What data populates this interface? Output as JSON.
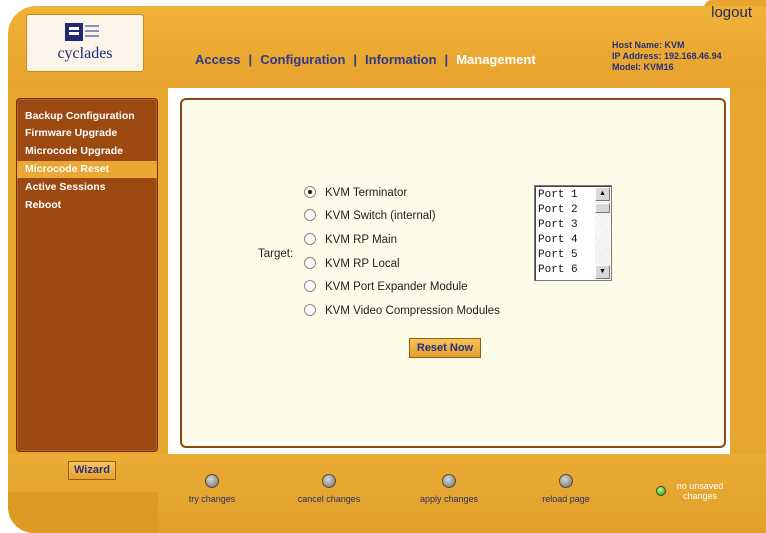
{
  "header": {
    "logo_text": "cyclades",
    "logout_label": "logout",
    "nav": [
      {
        "label": "Access",
        "active": false
      },
      {
        "label": "Configuration",
        "active": false
      },
      {
        "label": "Information",
        "active": false
      },
      {
        "label": "Management",
        "active": true
      }
    ],
    "separator": "|",
    "host_name": "Host Name: KVM",
    "ip_address": "IP Address: 192.168.46.94",
    "model": "Model: KVM16"
  },
  "sidebar": {
    "items": [
      {
        "label": "Backup Configuration",
        "selected": false
      },
      {
        "label": "Firmware Upgrade",
        "selected": false
      },
      {
        "label": "Microcode Upgrade",
        "selected": false
      },
      {
        "label": "Microcode Reset",
        "selected": true
      },
      {
        "label": "Active Sessions",
        "selected": false
      },
      {
        "label": "Reboot",
        "selected": false
      }
    ]
  },
  "main": {
    "target_label": "Target:",
    "targets": [
      {
        "label": "KVM Terminator",
        "checked": true
      },
      {
        "label": "KVM Switch (internal)",
        "checked": false
      },
      {
        "label": "KVM RP Main",
        "checked": false
      },
      {
        "label": "KVM RP Local",
        "checked": false
      },
      {
        "label": "KVM Port Expander Module",
        "checked": false
      },
      {
        "label": "KVM Video Compression Modules",
        "checked": false
      }
    ],
    "ports": [
      "Port 1",
      "Port 2",
      "Port 3",
      "Port 4",
      "Port 5",
      "Port 6"
    ],
    "reset_label": "Reset Now"
  },
  "footer": {
    "wizard_label": "Wizard",
    "actions": [
      {
        "label": "try changes"
      },
      {
        "label": "cancel changes"
      },
      {
        "label": "apply changes"
      },
      {
        "label": "reload page"
      }
    ],
    "status_text": "no unsaved changes"
  },
  "colors": {
    "frame": "#e7a62e",
    "sidebar": "#9d4a12",
    "content_bg": "#fdfce8",
    "nav_text": "#2f3a8a"
  }
}
